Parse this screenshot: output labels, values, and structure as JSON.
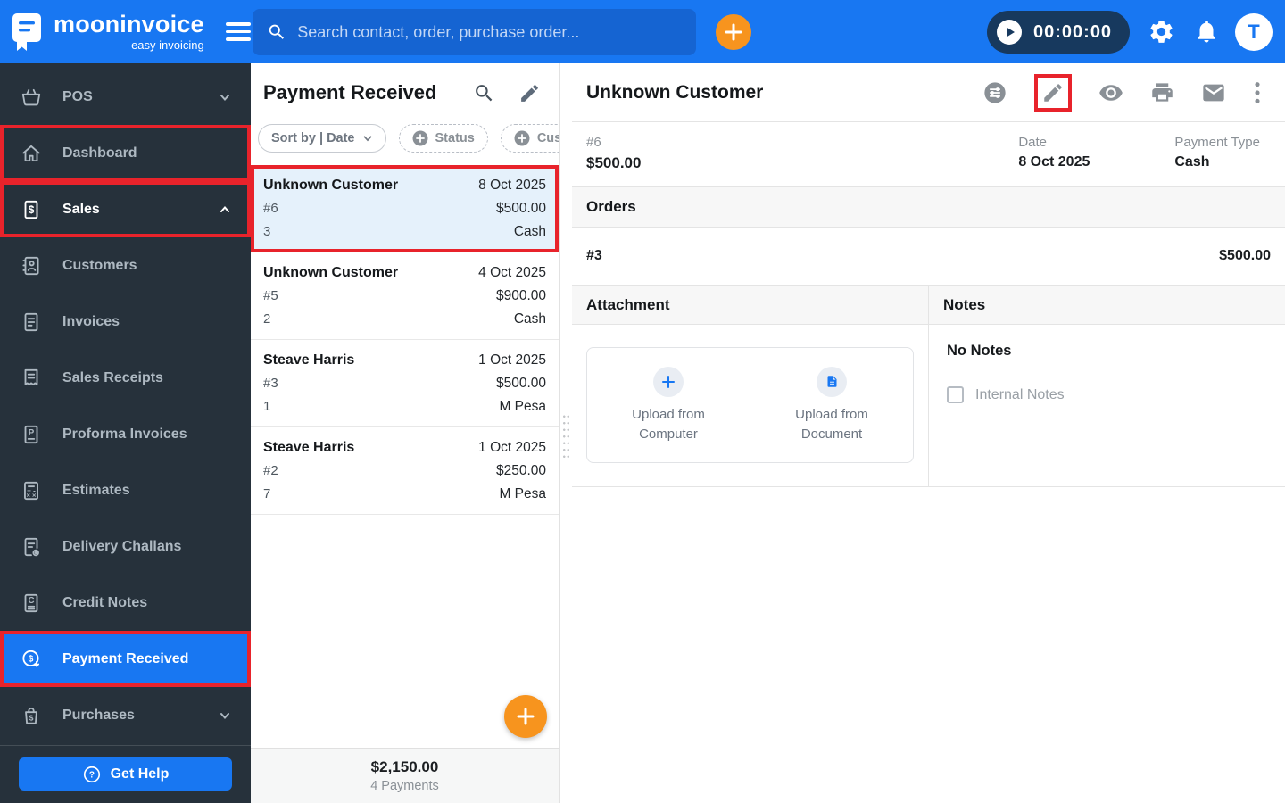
{
  "topbar": {
    "brand_name": "mooninvoice",
    "brand_tagline": "easy invoicing",
    "search_placeholder": "Search contact, order, purchase order...",
    "timer": "00:00:00",
    "avatar_initial": "T"
  },
  "sidebar": {
    "items": [
      {
        "label": "POS"
      },
      {
        "label": "Dashboard"
      },
      {
        "label": "Sales"
      },
      {
        "label": "Customers"
      },
      {
        "label": "Invoices"
      },
      {
        "label": "Sales Receipts"
      },
      {
        "label": "Proforma Invoices"
      },
      {
        "label": "Estimates"
      },
      {
        "label": "Delivery Challans"
      },
      {
        "label": "Credit Notes"
      },
      {
        "label": "Payment Received"
      },
      {
        "label": "Purchases"
      }
    ],
    "help_label": "Get Help"
  },
  "list_panel": {
    "title": "Payment Received",
    "filters": {
      "sort": "Sort by | Date",
      "status": "Status",
      "customer": "Customer"
    },
    "items": [
      {
        "name": "Unknown Customer",
        "date": "8 Oct 2025",
        "number": "#6",
        "amount": "$500.00",
        "count": "3",
        "method": "Cash"
      },
      {
        "name": "Unknown Customer",
        "date": "4 Oct 2025",
        "number": "#5",
        "amount": "$900.00",
        "count": "2",
        "method": "Cash"
      },
      {
        "name": "Steave Harris",
        "date": "1 Oct 2025",
        "number": "#3",
        "amount": "$500.00",
        "count": "1",
        "method": "M Pesa"
      },
      {
        "name": "Steave Harris",
        "date": "1 Oct 2025",
        "number": "#2",
        "amount": "$250.00",
        "count": "7",
        "method": "M Pesa"
      }
    ],
    "footer_total": "$2,150.00",
    "footer_count": "4 Payments"
  },
  "detail_panel": {
    "title": "Unknown Customer",
    "number": "#6",
    "amount": "$500.00",
    "date_label": "Date",
    "date": "8 Oct 2025",
    "type_label": "Payment Type",
    "type": "Cash",
    "orders_header": "Orders",
    "order_number": "#3",
    "order_amount": "$500.00",
    "attachment_header": "Attachment",
    "upload_computer": "Upload from Computer",
    "upload_document": "Upload from Document",
    "notes_header": "Notes",
    "no_notes": "No Notes",
    "internal_notes": "Internal Notes"
  },
  "colors": {
    "topbar_blue": "#1877F2",
    "accent_orange": "#F7941E",
    "sidebar_dark": "#26313B",
    "annotation_red": "#E8232B",
    "selected_row": "#E5F1FB",
    "timer_pill": "#17395E"
  }
}
